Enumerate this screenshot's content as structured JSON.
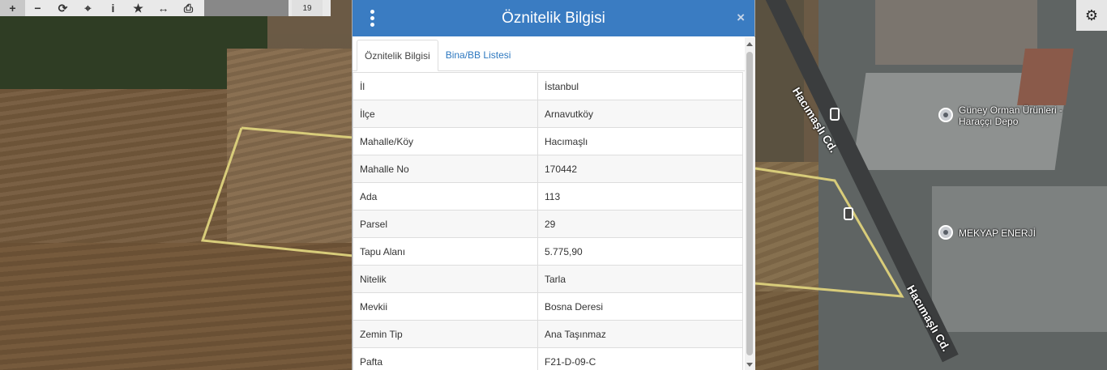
{
  "toolbar": {
    "buttons": [
      {
        "icon": "zoom-in-icon",
        "glyph": "+"
      },
      {
        "icon": "zoom-out-icon",
        "glyph": "−"
      },
      {
        "icon": "refresh-icon",
        "glyph": "⟳"
      },
      {
        "icon": "locate-icon",
        "glyph": "⌖"
      },
      {
        "icon": "info-icon",
        "glyph": "i"
      },
      {
        "icon": "star-icon",
        "glyph": "★"
      },
      {
        "icon": "measure-icon",
        "glyph": "↔"
      },
      {
        "icon": "print-icon",
        "glyph": "⎙"
      }
    ],
    "zoom_level": "19"
  },
  "dialog": {
    "title": "Öznitelik Bilgisi",
    "close": "×",
    "tabs": [
      {
        "label": "Öznitelik Bilgisi",
        "active": true
      },
      {
        "label": "Bina/BB Listesi",
        "active": false
      }
    ],
    "rows": [
      {
        "key": "İl",
        "value": "İstanbul"
      },
      {
        "key": "İlçe",
        "value": "Arnavutköy"
      },
      {
        "key": "Mahalle/Köy",
        "value": "Hacımaşlı"
      },
      {
        "key": "Mahalle No",
        "value": "170442"
      },
      {
        "key": "Ada",
        "value": "113"
      },
      {
        "key": "Parsel",
        "value": "29"
      },
      {
        "key": "Tapu Alanı",
        "value": "5.775,90"
      },
      {
        "key": "Nitelik",
        "value": "Tarla"
      },
      {
        "key": "Mevkii",
        "value": "Bosna Deresi"
      },
      {
        "key": "Zemin Tip",
        "value": "Ana Taşınmaz"
      },
      {
        "key": "Pafta",
        "value": "F21-D-09-C"
      }
    ]
  },
  "map": {
    "road_labels": [
      "Hacımaşlı Cd.",
      "Hacımaşlı Cd."
    ],
    "poi": [
      {
        "name": "Güney Orman Ürünleri - Haraççı Depo"
      },
      {
        "name": "MEKYAP ENERJİ"
      }
    ],
    "parcel_outline_color": "#d8cc7a"
  },
  "colors": {
    "header": "#3a7cc2",
    "tab_link": "#2d78c0"
  }
}
